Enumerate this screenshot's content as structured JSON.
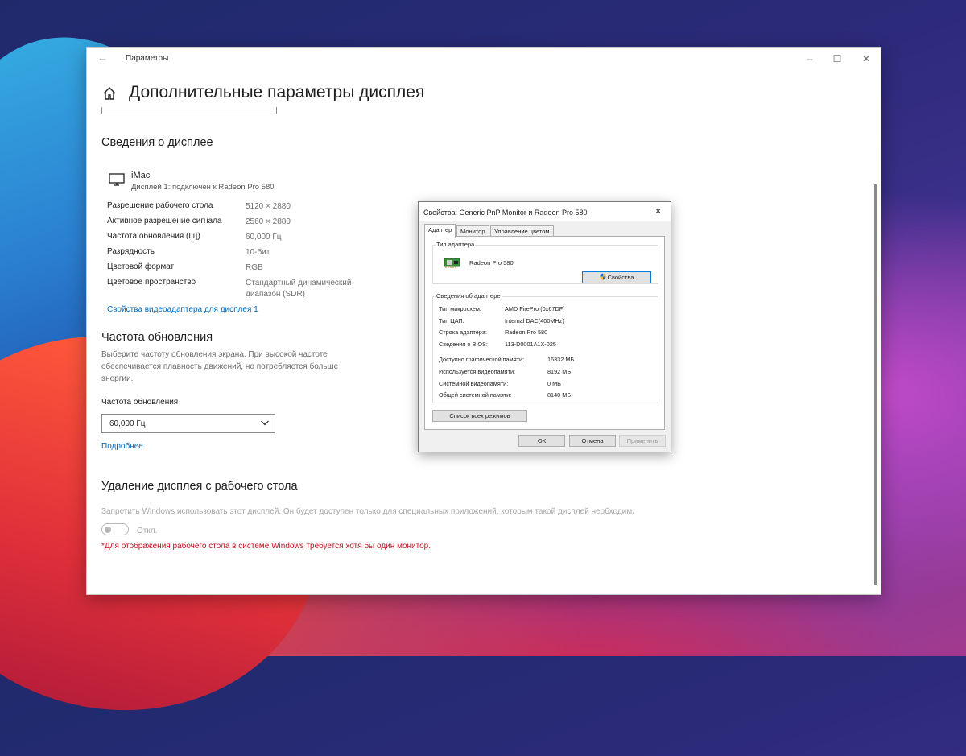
{
  "window": {
    "app_title": "Параметры",
    "page_title": "Дополнительные параметры дисплея"
  },
  "display_info": {
    "heading": "Сведения о дисплее",
    "monitor_name": "iMac",
    "monitor_sub": "Дисплей 1: подключен к Radeon Pro 580",
    "rows": [
      {
        "label": "Разрешение рабочего стола",
        "value": "5120 × 2880"
      },
      {
        "label": "Активное разрешение сигнала",
        "value": "2560 × 2880"
      },
      {
        "label": "Частота обновления (Гц)",
        "value": "60,000 Гц"
      },
      {
        "label": "Разрядность",
        "value": "10-бит"
      },
      {
        "label": "Цветовой формат",
        "value": "RGB"
      },
      {
        "label": "Цветовое пространство",
        "value": "Стандартный динамический диапазон (SDR)"
      }
    ],
    "adapter_link": "Свойства видеоадаптера для дисплея 1"
  },
  "refresh": {
    "heading": "Частота обновления",
    "description": "Выберите частоту обновления экрана. При высокой частоте обеспечивается плавность движений, но потребляется больше энергии.",
    "field_label": "Частота обновления",
    "selected": "60,000 Гц",
    "more_link": "Подробнее"
  },
  "remove": {
    "heading": "Удаление дисплея с рабочего стола",
    "description": "Запретить Windows использовать этот дисплей. Он будет доступен только для специальных приложений, которым такой дисплей необходим.",
    "toggle_label": "Откл.",
    "warning": "*Для отображения рабочего стола в системе Windows требуется хотя бы один монитор."
  },
  "dialog": {
    "title": "Свойства: Generic PnP Monitor и Radeon Pro 580",
    "tabs": [
      "Адаптер",
      "Монитор",
      "Управление цветом"
    ],
    "adapter_type_label": "Тип адаптера",
    "adapter_name": "Radeon Pro 580",
    "properties_button": "Свойства",
    "adapter_info_label": "Сведения об адаптере",
    "info": [
      {
        "label": "Тип микросхем:",
        "value": "AMD FirePro (0x67DF)"
      },
      {
        "label": "Тип ЦАП:",
        "value": "Internal DAC(400MHz)"
      },
      {
        "label": "Строка адаптера:",
        "value": "Radeon Pro 580"
      },
      {
        "label": "Сведения о BIOS:",
        "value": "113-D0001A1X-025"
      }
    ],
    "memory": [
      {
        "label": "Доступно графической памяти:",
        "value": "16332 МБ"
      },
      {
        "label": "Используется видеопамяти:",
        "value": "8192 МБ"
      },
      {
        "label": "Системной видеопамяти:",
        "value": "0 МБ"
      },
      {
        "label": "Общей системной памяти:",
        "value": "8140 МБ"
      }
    ],
    "list_modes_button": "Список всех режимов",
    "ok": "ОК",
    "cancel": "Отмена",
    "apply": "Применить"
  }
}
